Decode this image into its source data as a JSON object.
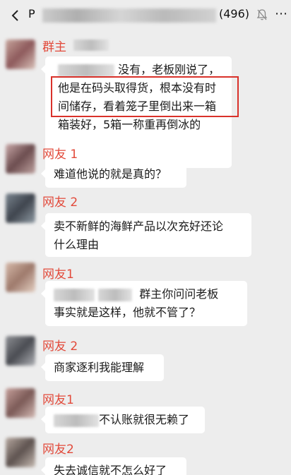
{
  "header": {
    "title_prefix": "P",
    "member_count": "(496)",
    "back_icon": "chevron-left-icon",
    "mute_icon": "bell-mute-icon",
    "more_icon": "more-dots-icon"
  },
  "colors": {
    "name_red": "#e24a3b",
    "highlight_red": "#d9312a",
    "bubble_bg": "#ffffff",
    "chat_bg": "#ededed"
  },
  "messages": [
    {
      "sender": "群主",
      "lines": [
        "没有，老板刚说了，",
        "他是在码头取得货，根本没有时",
        "间储存，看着笼子里倒出来一箱",
        "箱装好，5箱一称重再倒冰的"
      ]
    },
    {
      "sender": "网友 1",
      "lines": [
        "难道他说的就是真的？"
      ]
    },
    {
      "sender": "网友 2",
      "lines": [
        "卖不新鲜的海鲜产品以次充好还论",
        "什么理由"
      ]
    },
    {
      "sender": "网友1",
      "lines": [
        "群主你问问老板",
        "事实就是这样，他就不管了？"
      ]
    },
    {
      "sender": "网友 2",
      "lines": [
        "商家逐利我能理解"
      ]
    },
    {
      "sender": "网友1",
      "lines": [
        "不认账就很无赖了"
      ]
    },
    {
      "sender": "网友2",
      "lines": [
        "失去诚信就不怎么好了"
      ]
    }
  ]
}
